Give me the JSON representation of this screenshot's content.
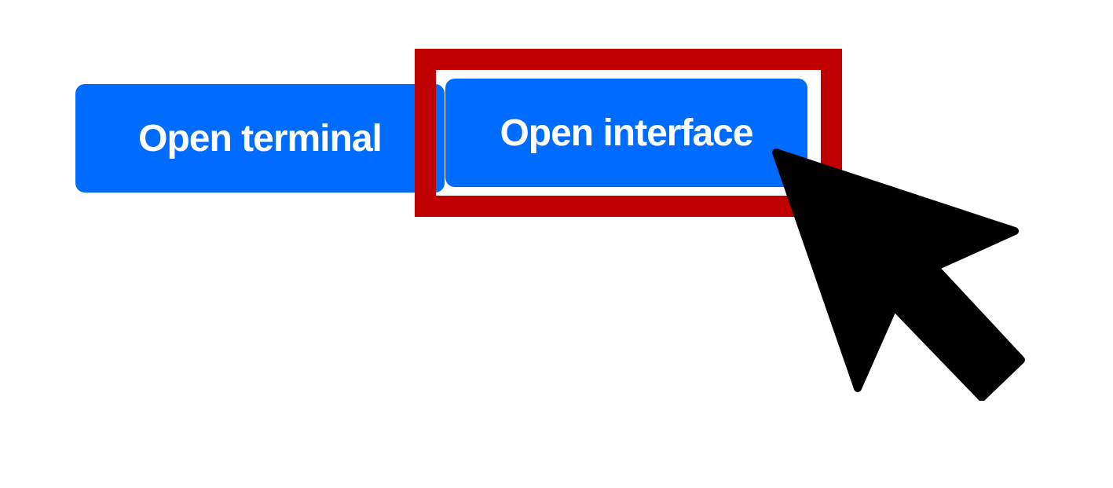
{
  "buttons": {
    "open_terminal_label": "Open terminal",
    "open_interface_label": "Open interface"
  },
  "colors": {
    "button_blue": "#006cff",
    "highlight_red": "#c00000",
    "cursor_black": "#000000",
    "background": "#ffffff"
  },
  "icons": {
    "cursor": "mouse-pointer-arrow-icon"
  }
}
